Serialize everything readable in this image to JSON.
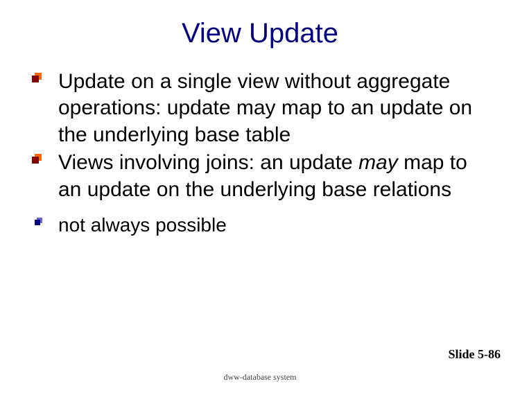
{
  "title": "View Update",
  "bullets": [
    {
      "text": "Update on a single view without aggregate operations: update may map to an update on the underlying base table"
    },
    {
      "prefix": "Views involving joins: an update ",
      "italic": "may",
      "suffix": " map to an update on the underlying base relations"
    }
  ],
  "subbullets": [
    {
      "text": "not always possible"
    }
  ],
  "slide_number": "Slide 5-86",
  "footer": "dww-database system"
}
